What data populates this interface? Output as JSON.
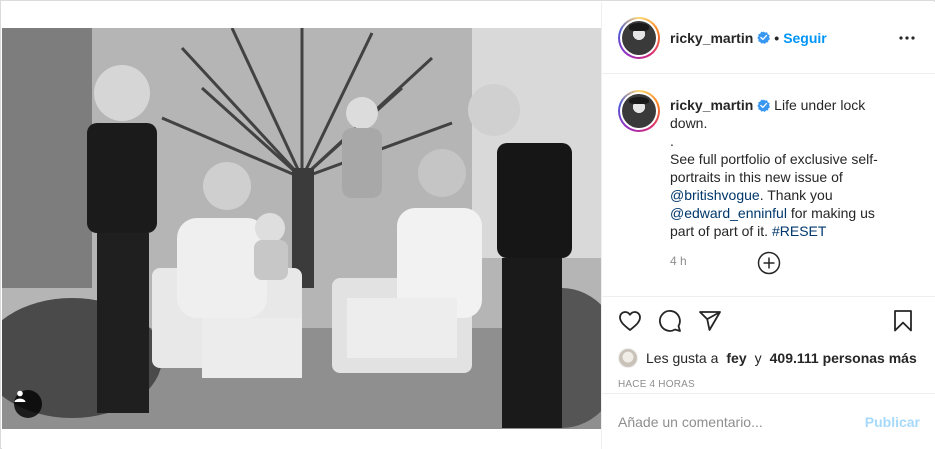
{
  "post": {
    "username": "ricky_martin",
    "verified": true,
    "follow_label": "Seguir",
    "more_icon": "more-options-icon",
    "photo_alt": "Black and white photo of a family in a garden"
  },
  "caption": {
    "username": "ricky_martin",
    "line1": "Life under lock down.",
    "line2": ".",
    "line3": "See full portfolio of exclusive self-portraits in this new issue of",
    "mention1": "@britishvogue",
    "line4": ". Thank you",
    "mention2": "@edward_enninful",
    "line5": "for making us part of part of it.",
    "hashtag": "#RESET",
    "time": "4 h"
  },
  "actions": {
    "like_icon": "heart-icon",
    "comment_icon": "comment-icon",
    "share_icon": "share-icon",
    "save_icon": "bookmark-icon",
    "load_more_icon": "plus-circle-icon"
  },
  "likes": {
    "prefix": "Les gusta a",
    "first_user": "fey",
    "join": "y",
    "count": "409.111 personas más"
  },
  "timestamp": "HACE 4 HORAS",
  "comment_box": {
    "placeholder": "Añade un comentario...",
    "publish_label": "Publicar"
  },
  "colors": {
    "link_blue": "#0095f6",
    "mention_blue": "#00376b",
    "muted": "#8e8e8e",
    "border": "#dbdbdb"
  }
}
